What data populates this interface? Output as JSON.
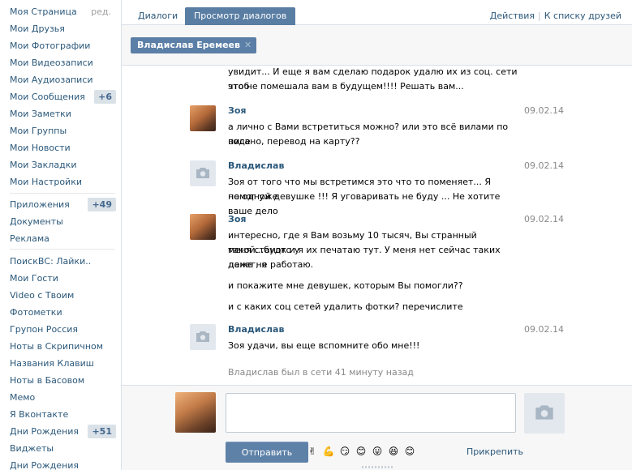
{
  "sidebar": {
    "edit_label": "ред.",
    "items": [
      {
        "label": "Моя Страница"
      },
      {
        "label": "Мои Друзья"
      },
      {
        "label": "Мои Фотографии"
      },
      {
        "label": "Мои Видеозаписи"
      },
      {
        "label": "Мои Аудиозаписи"
      },
      {
        "label": "Мои Сообщения",
        "badge": "+6"
      },
      {
        "label": "Мои Заметки"
      },
      {
        "label": "Мои Группы"
      },
      {
        "label": "Мои Новости"
      },
      {
        "label": "Мои Закладки"
      },
      {
        "label": "Мои Настройки"
      },
      {
        "label": "Приложения",
        "badge": "+49"
      },
      {
        "label": "Документы"
      },
      {
        "label": "Реклама"
      },
      {
        "label": "ПоискВС: Лайки.."
      },
      {
        "label": "Мои Гости"
      },
      {
        "label": "Video с Твоим"
      },
      {
        "label": "Фотометки"
      },
      {
        "label": "Групон Россия"
      },
      {
        "label": "Ноты в Скрипичном"
      },
      {
        "label": "Названия Клавиш"
      },
      {
        "label": "Ноты в Басовом"
      },
      {
        "label": "Мемо"
      },
      {
        "label": "Я Вконтакте"
      },
      {
        "label": "Дни Рождения",
        "badge": "+51"
      },
      {
        "label": "Виджеты"
      },
      {
        "label": "Дни Рождения"
      }
    ]
  },
  "tabs": {
    "dialogs": "Диалоги",
    "view_dialogs": "Просмотр диалогов"
  },
  "top_links": {
    "actions": "Действия",
    "separator": "|",
    "to_friends": "К списку друзей"
  },
  "peer": {
    "name": "Владислав Еремеев",
    "close": "✕"
  },
  "history": {
    "continued_text": [
      "увидит... И еще я вам сделаю подарок удалю их из соц. сети чтоб",
      "это не помешала вам в будущем!!!! Решать вам..."
    ],
    "messages": [
      {
        "author": "Зоя",
        "date": "09.02.14",
        "avatar": "photo",
        "lines": [
          "а лично с Вами встретиться можно? или это всё вилами по воде",
          "писано, перевод на карту??"
        ]
      },
      {
        "author": "Владислав",
        "date": "09.02.14",
        "avatar": "camera-icon",
        "lines": [
          "Зоя от того что мы встретимся это что то поменяет... Я помог уже",
          "не одной девушке !!! Я уговаривать не буду ... Не хотите ваше дело"
        ]
      },
      {
        "author": "Зоя",
        "date": "09.02.14",
        "avatar": "photo",
        "lines": [
          "интересно, где я Вам возьму 10 тысяч, Вы странный такой...будто у",
          "меня станок и я их печатаю тут. У меня нет сейчас таких денег, я",
          "даже не работаю.",
          "и покажите мне девушек, которым Вы помогли??",
          "и с каких соц сетей удалить фотки? перечислите"
        ]
      },
      {
        "author": "Владислав",
        "date": "09.02.14",
        "avatar": "camera-icon",
        "lines": [
          "Зоя удачи, вы еще вспомните обо мне!!!"
        ]
      }
    ],
    "status": "Владислав был в сети 41 минуту назад"
  },
  "composer": {
    "input_value": "",
    "send_label": "Отправить",
    "attach_label": "Прикрепить",
    "emojis": [
      "✌",
      "💪",
      "😏",
      "😊",
      "😛",
      "😆",
      "😊"
    ]
  },
  "colors": {
    "link": "#2B587A",
    "accent": "#597DA3",
    "badge_bg": "#DAE2E8"
  }
}
